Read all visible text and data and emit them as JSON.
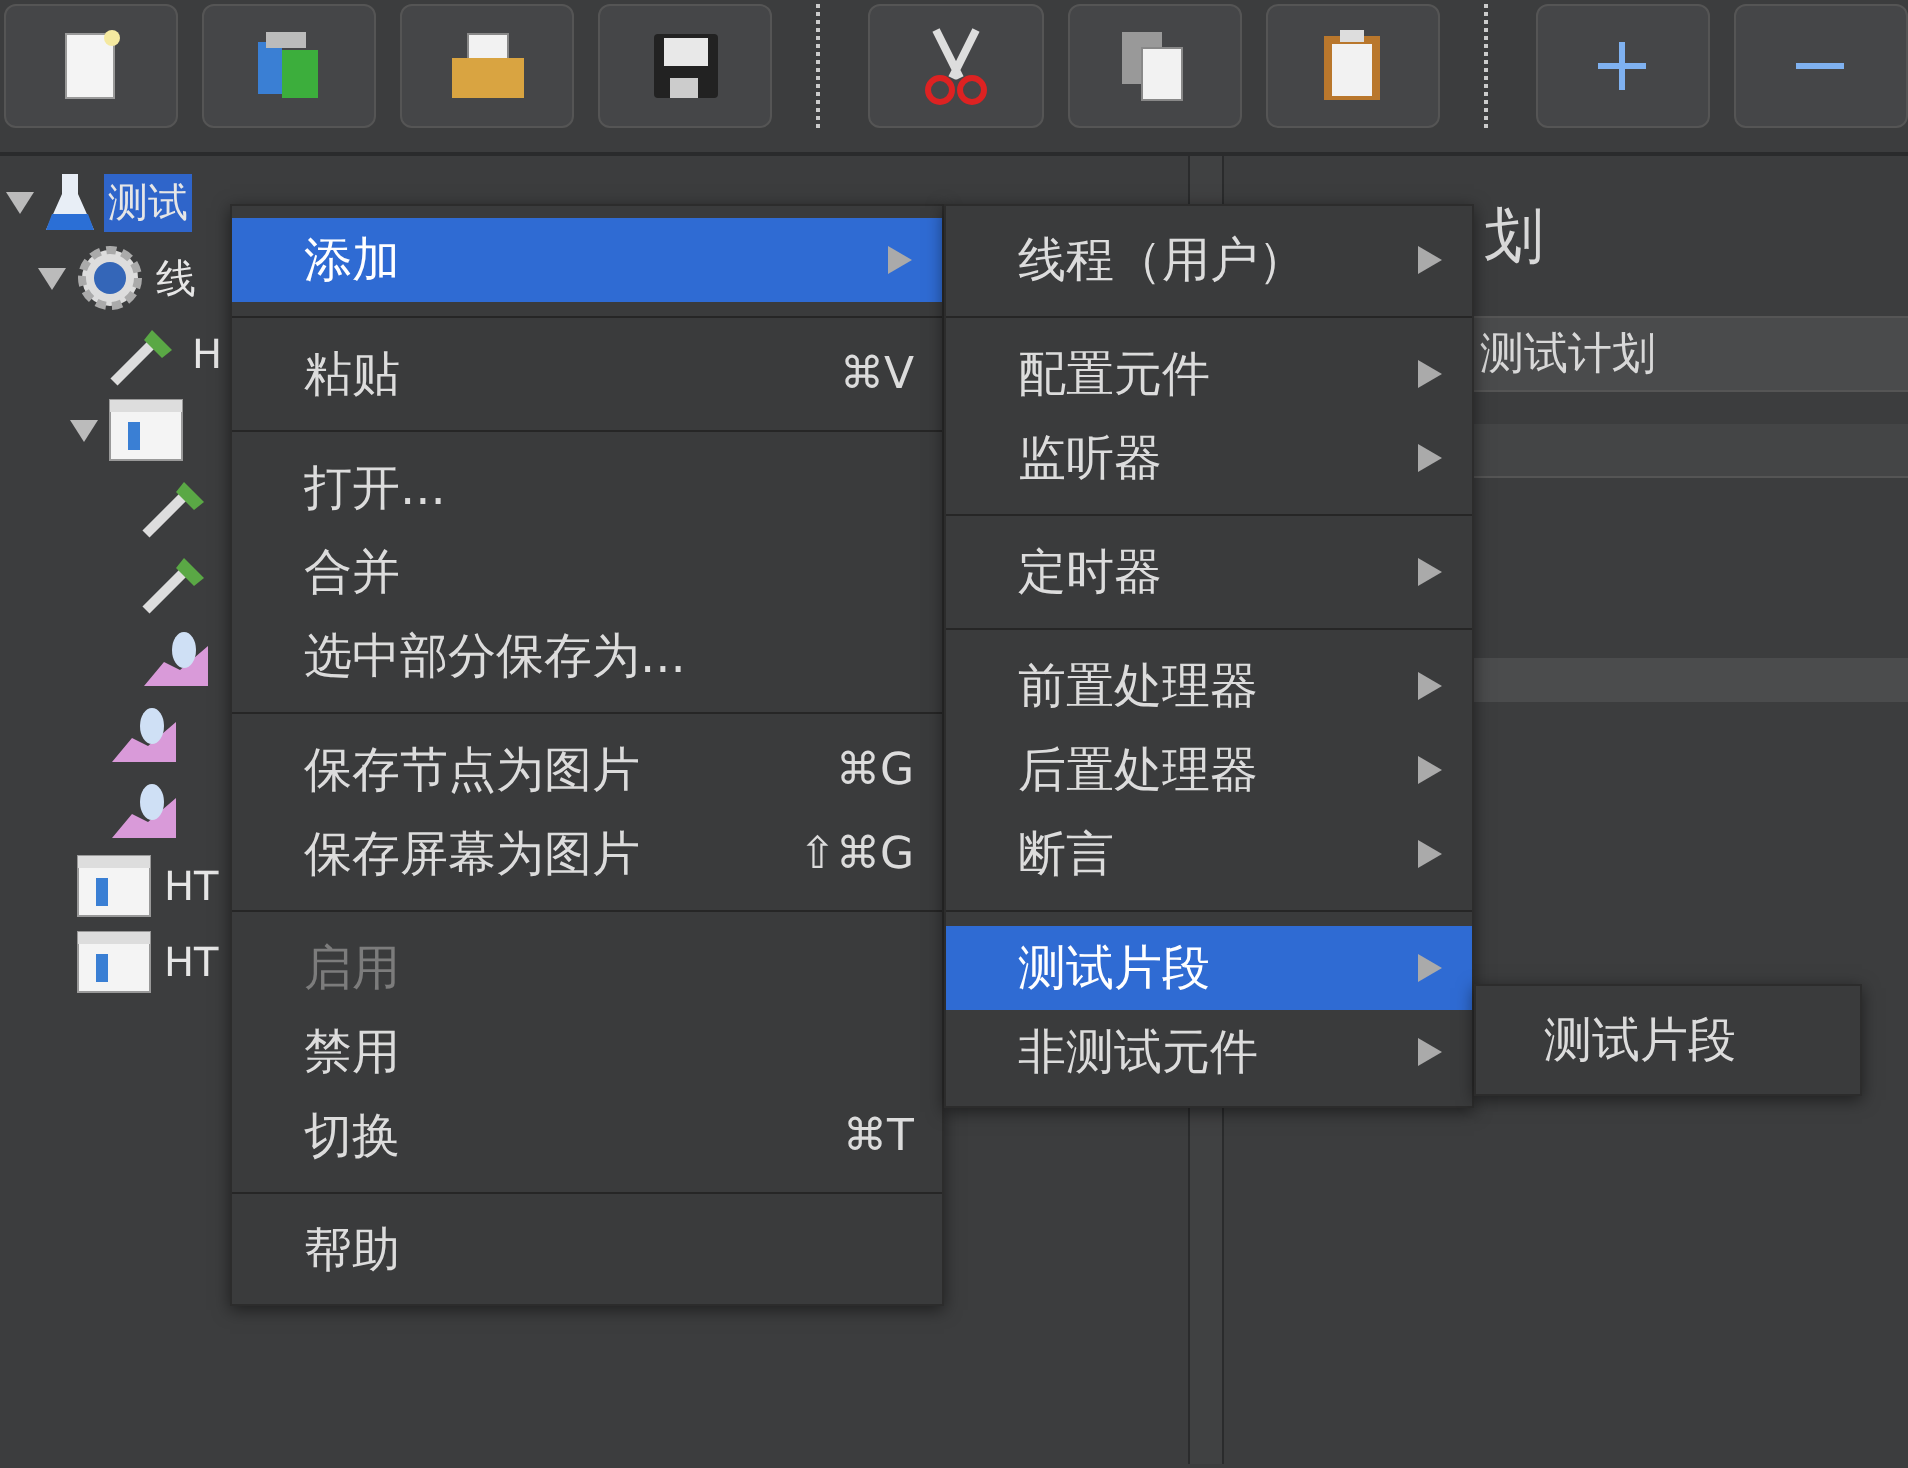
{
  "toolbar": [
    {
      "kind": "new"
    },
    {
      "kind": "templates"
    },
    {
      "kind": "open"
    },
    {
      "kind": "save"
    },
    {
      "kind": "separator"
    },
    {
      "kind": "cut"
    },
    {
      "kind": "copy"
    },
    {
      "kind": "paste"
    },
    {
      "kind": "separator"
    },
    {
      "kind": "add"
    },
    {
      "kind": "remove"
    }
  ],
  "tree": [
    {
      "kind": "plan",
      "label": "测试",
      "selected": true,
      "expanded": true,
      "children": [
        {
          "kind": "thread",
          "label": "线",
          "selected": false,
          "expanded": true,
          "children": [
            {
              "kind": "sampler",
              "label": "H",
              "selected": false
            },
            {
              "kind": "controller",
              "selected": false,
              "expanded": true,
              "children": [
                {
                  "kind": "sampler",
                  "selected": false
                },
                {
                  "kind": "sampler",
                  "selected": false
                },
                {
                  "kind": "listener",
                  "selected": false
                }
              ]
            },
            {
              "kind": "listener",
              "selected": false
            },
            {
              "kind": "listener",
              "selected": false
            }
          ]
        },
        {
          "kind": "controller",
          "label": "HT",
          "selected": false
        },
        {
          "kind": "controller",
          "label": "HT",
          "selected": false
        }
      ]
    }
  ],
  "panel": {
    "title": "划",
    "name_value": "测试计划"
  },
  "context_menu": [
    [
      {
        "label": "添加",
        "selected": true,
        "disabled": false,
        "submenu": true
      }
    ],
    [
      {
        "label": "粘贴",
        "shortcut": "⌘V",
        "selected": false,
        "disabled": false,
        "submenu": false
      }
    ],
    [
      {
        "label": "打开...",
        "selected": false,
        "disabled": false,
        "submenu": false
      },
      {
        "label": "合并",
        "selected": false,
        "disabled": false,
        "submenu": false
      },
      {
        "label": "选中部分保存为...",
        "selected": false,
        "disabled": false,
        "submenu": false
      }
    ],
    [
      {
        "label": "保存节点为图片",
        "shortcut": "⌘G",
        "selected": false,
        "disabled": false,
        "submenu": false
      },
      {
        "label": "保存屏幕为图片",
        "shortcut": "⇧⌘G",
        "selected": false,
        "disabled": false,
        "submenu": false
      }
    ],
    [
      {
        "label": "启用",
        "selected": false,
        "disabled": true,
        "submenu": false
      },
      {
        "label": "禁用",
        "selected": false,
        "disabled": false,
        "submenu": false
      },
      {
        "label": "切换",
        "shortcut": "⌘T",
        "selected": false,
        "disabled": false,
        "submenu": false
      }
    ],
    [
      {
        "label": "帮助",
        "selected": false,
        "disabled": false,
        "submenu": false
      }
    ]
  ],
  "add_submenu": [
    [
      {
        "label": "线程（用户）",
        "selected": false,
        "submenu": true
      }
    ],
    [
      {
        "label": "配置元件",
        "selected": false,
        "submenu": true
      },
      {
        "label": "监听器",
        "selected": false,
        "submenu": true
      }
    ],
    [
      {
        "label": "定时器",
        "selected": false,
        "submenu": true
      }
    ],
    [
      {
        "label": "前置处理器",
        "selected": false,
        "submenu": true
      },
      {
        "label": "后置处理器",
        "selected": false,
        "submenu": true
      },
      {
        "label": "断言",
        "selected": false,
        "submenu": true
      }
    ],
    [
      {
        "label": "测试片段",
        "selected": true,
        "submenu": true
      },
      {
        "label": "非测试元件",
        "selected": false,
        "submenu": true
      }
    ]
  ],
  "fragment_submenu": [
    {
      "label": "测试片段",
      "selected": false
    }
  ]
}
